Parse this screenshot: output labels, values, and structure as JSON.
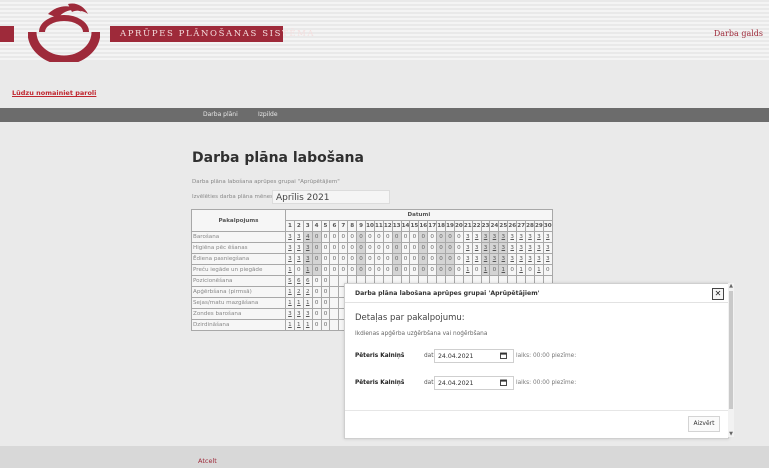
{
  "header": {
    "brand": "APRŪPES PLĀNOŠANAS SISTĒMA",
    "right_link": "Darba galds"
  },
  "notice_link": "Lūdzu nomainiet paroli",
  "nav": {
    "items": [
      "Darba plāni",
      "Izpilde"
    ]
  },
  "main": {
    "title": "Darba plāna labošana",
    "subtitle": "Darba plāna labošana aprūpes grupai \"Aprūpētājiem\"",
    "month_label": "Izvēlēties darba plāna mēnesi:",
    "month_value": "Aprīlis 2021"
  },
  "table": {
    "header_service": "Pakalpojums",
    "header_dates": "Datumi",
    "days": [
      "1",
      "2",
      "3",
      "4",
      "5",
      "6",
      "7",
      "8",
      "9",
      "10",
      "11",
      "12",
      "13",
      "14",
      "15",
      "16",
      "17",
      "18",
      "19",
      "20",
      "21",
      "22",
      "23",
      "24",
      "25",
      "26",
      "27",
      "28",
      "29",
      "30"
    ],
    "rows": [
      {
        "label": "Barošana",
        "values": [
          "3",
          "3",
          "4",
          "0",
          "0",
          "0",
          "0",
          "0",
          "0",
          "0",
          "0",
          "0",
          "0",
          "0",
          "0",
          "0",
          "0",
          "0",
          "0",
          "0",
          "3",
          "3",
          "3",
          "3",
          "3",
          "3",
          "3",
          "3",
          "3",
          "3"
        ]
      },
      {
        "label": "Higiēna pēc ēšanas",
        "values": [
          "3",
          "3",
          "3",
          "0",
          "0",
          "0",
          "0",
          "0",
          "0",
          "0",
          "0",
          "0",
          "0",
          "0",
          "0",
          "0",
          "0",
          "0",
          "0",
          "0",
          "3",
          "3",
          "3",
          "3",
          "3",
          "3",
          "3",
          "3",
          "3",
          "3"
        ]
      },
      {
        "label": "Ēdiena pasniegšana",
        "values": [
          "3",
          "3",
          "3",
          "0",
          "0",
          "0",
          "0",
          "0",
          "0",
          "0",
          "0",
          "0",
          "0",
          "0",
          "0",
          "0",
          "0",
          "0",
          "0",
          "0",
          "3",
          "3",
          "3",
          "3",
          "3",
          "3",
          "3",
          "3",
          "3",
          "3"
        ]
      },
      {
        "label": "Preču iegāde un piegāde",
        "values": [
          "1",
          "0",
          "1",
          "0",
          "0",
          "0",
          "0",
          "0",
          "0",
          "0",
          "0",
          "0",
          "0",
          "0",
          "0",
          "0",
          "0",
          "0",
          "0",
          "0",
          "1",
          "0",
          "1",
          "0",
          "1",
          "0",
          "1",
          "0",
          "1",
          "0"
        ]
      },
      {
        "label": "Pozicionēšana",
        "values": [
          "5",
          "6",
          "6",
          "0",
          "0"
        ]
      },
      {
        "label": "Apģērbšana (pirmsā)",
        "values": [
          "1",
          "2",
          "2",
          "0",
          "0"
        ]
      },
      {
        "label": "Sejas/matu mazgāšana",
        "values": [
          "1",
          "1",
          "1",
          "0",
          "0"
        ]
      },
      {
        "label": "Zondes barošana",
        "values": [
          "3",
          "3",
          "3",
          "0",
          "0"
        ]
      },
      {
        "label": "Dzirdināšana",
        "values": [
          "1",
          "1",
          "1",
          "0",
          "0"
        ]
      }
    ]
  },
  "modal": {
    "title": "Darba plāna labošana aprūpes grupai 'Aprūpētājiem'",
    "close_glyph": "✕",
    "heading": "Detaļas par pakalpojumu:",
    "description": "Ikdienas apģērba uzģērbšana vai noģērbšana",
    "entries": [
      {
        "name": "Pēteris Kalniņš",
        "date_label": "datums",
        "date": "24.04.2021",
        "time_label": "laiks: 00:00 piezīme:"
      },
      {
        "name": "Pēteris Kalniņš",
        "date_label": "datums",
        "date": "24.04.2021",
        "time_label": "laiks: 00:00 piezīme:"
      }
    ],
    "close_button": "Aizvērt"
  },
  "footer": {
    "cancel": "Atcelt"
  },
  "colors": {
    "brand": "#9e2a3a",
    "nav": "#6c6c6c",
    "link": "#c0262f"
  }
}
